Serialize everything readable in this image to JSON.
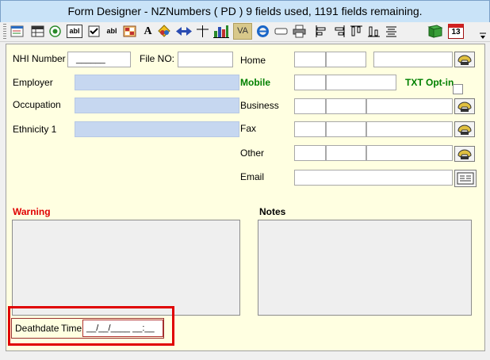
{
  "window": {
    "title": "Form Designer - NZNumbers ( PD ) 9 fields used, 1191 fields remaining."
  },
  "toolbar": {
    "icons": [
      "form-icon",
      "table-icon",
      "radio-icon",
      "textbox-icon",
      "checkbox-icon",
      "label-icon",
      "grid-icon",
      "font-icon",
      "color-icon",
      "arrows-icon",
      "crosshair-icon",
      "chart-icon",
      "va-icon",
      "ie-icon",
      "blank-icon",
      "print-icon",
      "align-left-icon",
      "align-right-icon",
      "align-top-icon",
      "align-bottom-icon",
      "align-center-icon",
      "book-icon",
      "calendar-icon"
    ],
    "text_icons": {
      "textbox": "abl",
      "label": "abl",
      "font": "A",
      "va": "VA",
      "calendar": "13"
    }
  },
  "form": {
    "nhi_label": "NHI Number",
    "nhi_value": "______",
    "fileno_label": "File NO:",
    "employer_label": "Employer",
    "occupation_label": "Occupation",
    "ethnicity_label": "Ethnicity 1",
    "home_label": "Home",
    "mobile_label": "Mobile",
    "txt_optin_label": "TXT Opt-in",
    "business_label": "Business",
    "fax_label": "Fax",
    "other_label": "Other",
    "email_label": "Email",
    "warning_label": "Warning",
    "notes_label": "Notes",
    "deathdate_label": "Deathdate",
    "time_label": "Time",
    "deathdate_value": "__/__/____ __:__"
  },
  "colors": {
    "form_bg": "#ffffe1",
    "readonly_field": "#c6d7f0",
    "mobile": "#008000",
    "warning": "#e00000",
    "highlight": "#e00000"
  }
}
